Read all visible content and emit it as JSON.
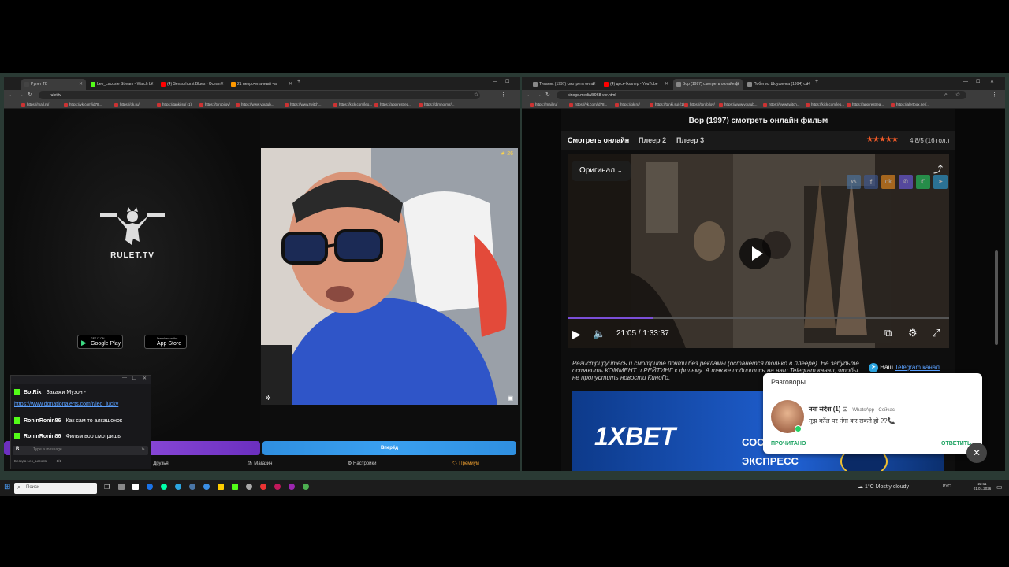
{
  "left_browser": {
    "tabs": [
      "Рулет ТВ",
      "Leo_Lacoste Stream - Watch Li",
      "(4) Sensorhurst Blues - Ocean",
      "21 непрочитанный чат"
    ],
    "url": "rulet.tv",
    "bookmarks": [
      "https://mail.ru/",
      "https://vk.com/id78...",
      "https://ok.ru/",
      "https://tanki.su/ (1)",
      "https://torobilov/",
      "https://www.youtub...",
      "https://www.twitch...",
      "https://kick.com/leo...",
      "https://app.restrea...",
      "https://dtmno.mir/..."
    ]
  },
  "rulet": {
    "logo_text": "RULET.TV",
    "google_play_small": "GET IT ON",
    "google_play": "Google Play",
    "app_store_small": "Download on the",
    "app_store": "App Store",
    "viewer_count": "26",
    "start_button": "Вперёд",
    "nav": {
      "friends": "Друзья",
      "shop": "Магазин",
      "settings": "Настройки",
      "premium": "Премиум"
    }
  },
  "chat": {
    "messages": [
      {
        "user": "BotRix",
        "text": "Закажи Музон -"
      },
      {
        "user": "",
        "text": "https://www.donationalerts.com/r/leo_lucky",
        "link": true
      },
      {
        "user": "RoninRonin86",
        "text": "Как сам то алкашонок"
      },
      {
        "user": "RoninRonin86",
        "text": "Фильм вор смотришь"
      }
    ],
    "input_placeholder": "Type a message...",
    "footer_user": "Беседа Leo_Lacoste",
    "footer_count": "1/1"
  },
  "right_browser": {
    "tabs": [
      "Титаник (1997) смотреть онла",
      "(4) диск-боллер - YouTube",
      "Вор (1997) смотреть онлайн ф",
      "Побег из Шоушенка (1994) см"
    ],
    "url": "kinogo.media/8968-vor.html",
    "bookmarks": [
      "https://mail.ru/",
      "https://vk.com/id78...",
      "https://ok.ru/",
      "https://tanki.su/ (1)",
      "https://torobilov/",
      "https://www.youtub...",
      "https://www.twitch...",
      "https://kick.com/leo...",
      "https://app.restrea...",
      "https://alertbox.net/..."
    ]
  },
  "kinogo": {
    "title": "Вор (1997) смотреть онлайн фильм",
    "tabs": [
      "Смотреть онлайн",
      "Плеер 2",
      "Плеер 3"
    ],
    "rating": "4.8/5 (16 гол.)",
    "rating_stars": 5,
    "quality": "Оригинал",
    "time": "21:05 / 1:33:37",
    "progress": 0.225,
    "notice": "Регистрируйтесь и смотрите почти без рекламы (останется только в плеере). Не забудьте оставить КОММЕНТ и РЕЙТИНГ к фильму. А также подпишись на наш Telegram канал, чтобы не пропустить новости КиноГо.",
    "telegram_prefix": "Наш",
    "telegram_link": "Telegram канал",
    "banner_brand": "1XBET",
    "banner_text1": "СОС",
    "banner_text2": "ЭКСПРЕСС"
  },
  "notification": {
    "title": "Разговоры",
    "sender": "नया संदेश (1)",
    "app": "WhatsApp",
    "time": "Сейчас",
    "message": "मुझ कॉल पर नंगा कर सकते हो ??📞",
    "dismiss": "ПРОЧИТАНО",
    "reply": "ОТВЕТИТЬ"
  },
  "taskbar": {
    "search_placeholder": "Поиск",
    "weather": "1°C  Mostly cloudy",
    "lang": "РУС",
    "clock_time": "22:11",
    "clock_date": "01.01.2026"
  }
}
